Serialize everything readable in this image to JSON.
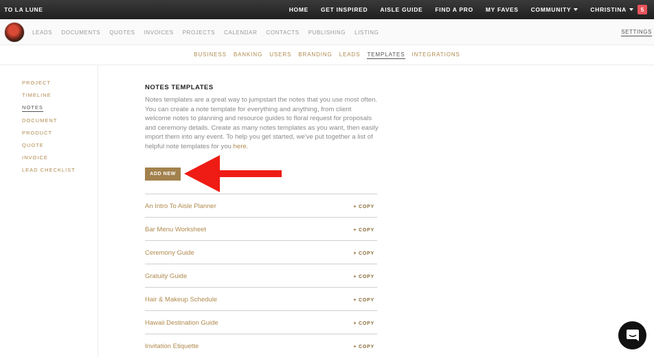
{
  "brand": "TO LA LUNE",
  "top_nav": [
    {
      "label": "HOME",
      "caret": false
    },
    {
      "label": "GET INSPIRED",
      "caret": false
    },
    {
      "label": "AISLE GUIDE",
      "caret": false
    },
    {
      "label": "FIND A PRO",
      "caret": false
    },
    {
      "label": "MY FAVES",
      "caret": false
    },
    {
      "label": "COMMUNITY",
      "caret": true
    },
    {
      "label": "CHRISTINA",
      "caret": true
    }
  ],
  "notification_count": "5",
  "main_nav": [
    "LEADS",
    "DOCUMENTS",
    "QUOTES",
    "INVOICES",
    "PROJECTS",
    "CALENDAR",
    "CONTACTS",
    "PUBLISHING",
    "LISTING"
  ],
  "settings_label": "SETTINGS",
  "settings_tabs": [
    "BUSINESS",
    "BANKING",
    "USERS",
    "BRANDING",
    "LEADS",
    "TEMPLATES",
    "INTEGRATIONS"
  ],
  "active_settings_tab": "TEMPLATES",
  "sidebar": [
    "PROJECT",
    "TIMELINE",
    "NOTES",
    "DOCUMENT",
    "PRODUCT",
    "QUOTE",
    "INVOICE",
    "LEAD CHECKLIST"
  ],
  "active_sidebar": "NOTES",
  "content": {
    "heading": "NOTES TEMPLATES",
    "intro": "Notes templates are a great way to jumpstart the notes that you use most often. You can create a note template for everything and anything, from client welcome notes to planning and resource guides to floral request for proposals and ceremony details. Create as many notes templates as you want, then easily import them into any event. To help you get started, we've put together a list of helpful note templates for you",
    "intro_link": "here",
    "intro_end": ".",
    "add_new_label": "ADD NEW",
    "copy_label": "+ COPY",
    "templates": [
      "An Intro To Aisle Planner",
      "Bar Menu Worksheet",
      "Ceremony Guide",
      "Gratuity Guide",
      "Hair & Makeup Schedule",
      "Hawaii Destination Guide",
      "Invitation Etiquette"
    ]
  },
  "colors": {
    "accent": "#b08a4e",
    "button": "#a2814d",
    "arrow": "#ee1c14",
    "badge": "#e8545c"
  }
}
